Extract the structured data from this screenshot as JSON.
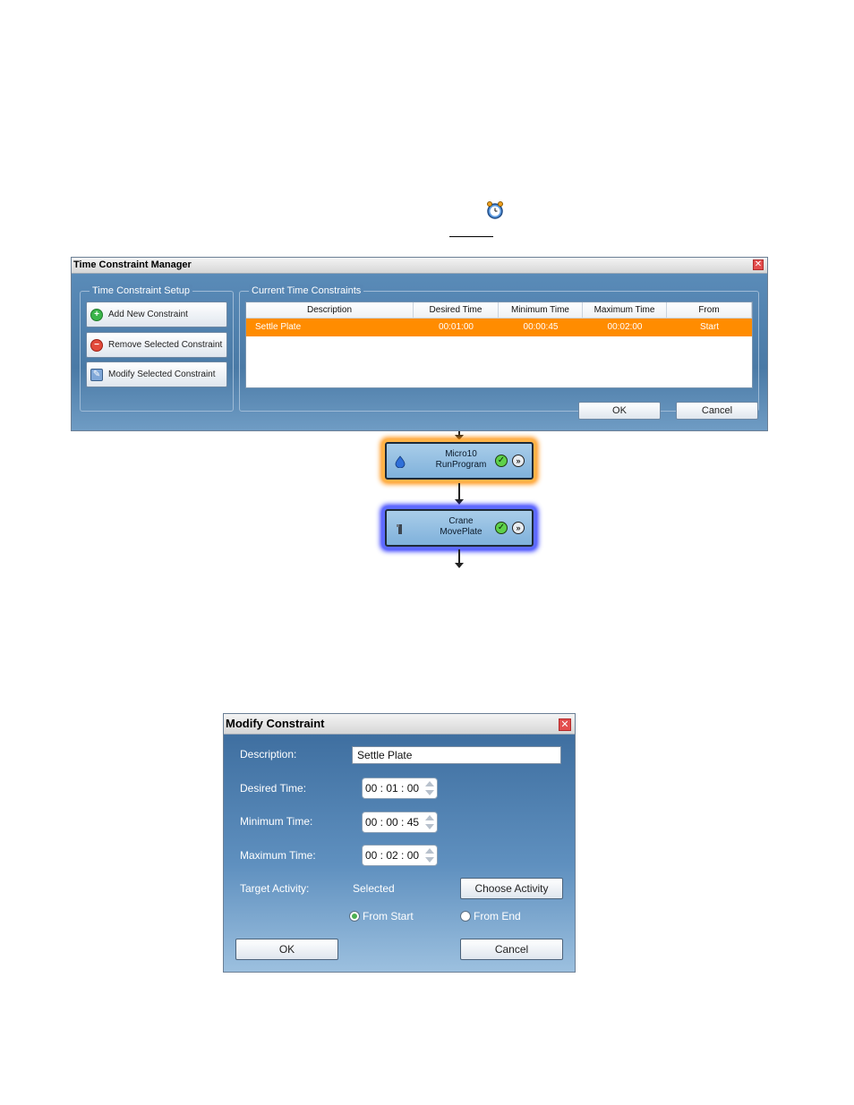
{
  "alarm_icon": "alarm-clock-icon",
  "tcm": {
    "title": "Time Constraint Manager",
    "setup_group": "Time Constraint Setup",
    "current_group": "Current Time Constraints",
    "buttons": {
      "add": "Add New Constraint",
      "remove": "Remove Selected Constraint",
      "modify": "Modify Selected Constraint"
    },
    "columns": [
      "Description",
      "Desired Time",
      "Minimum Time",
      "Maximum Time",
      "From"
    ],
    "rows": [
      {
        "description": "Settle Plate",
        "desired": "00:01:00",
        "minimum": "00:00:45",
        "maximum": "00:02:00",
        "from": "Start"
      }
    ],
    "ok": "OK",
    "cancel": "Cancel",
    "selection_color": "#ff8c00"
  },
  "workflow": {
    "nodes": [
      {
        "line1": "Micro10",
        "line2": "RunProgram",
        "icon": "droplet-icon",
        "highlight": "#ff8c00"
      },
      {
        "line1": "Crane",
        "line2": "MovePlate",
        "icon": "crane-icon",
        "highlight": "#1e28ff"
      }
    ]
  },
  "modify": {
    "title": "Modify Constraint",
    "description_label": "Description:",
    "description_value": "Settle Plate",
    "desired_label": "Desired Time:",
    "desired_value": "00 : 01 : 00",
    "minimum_label": "Minimum Time:",
    "minimum_value": "00 : 00 : 45",
    "maximum_label": "Maximum Time:",
    "maximum_value": "00 : 02 : 00",
    "target_label": "Target Activity:",
    "target_value": "Selected",
    "choose_activity": "Choose Activity",
    "from_start": "From Start",
    "from_end": "From End",
    "ok": "OK",
    "cancel": "Cancel"
  }
}
